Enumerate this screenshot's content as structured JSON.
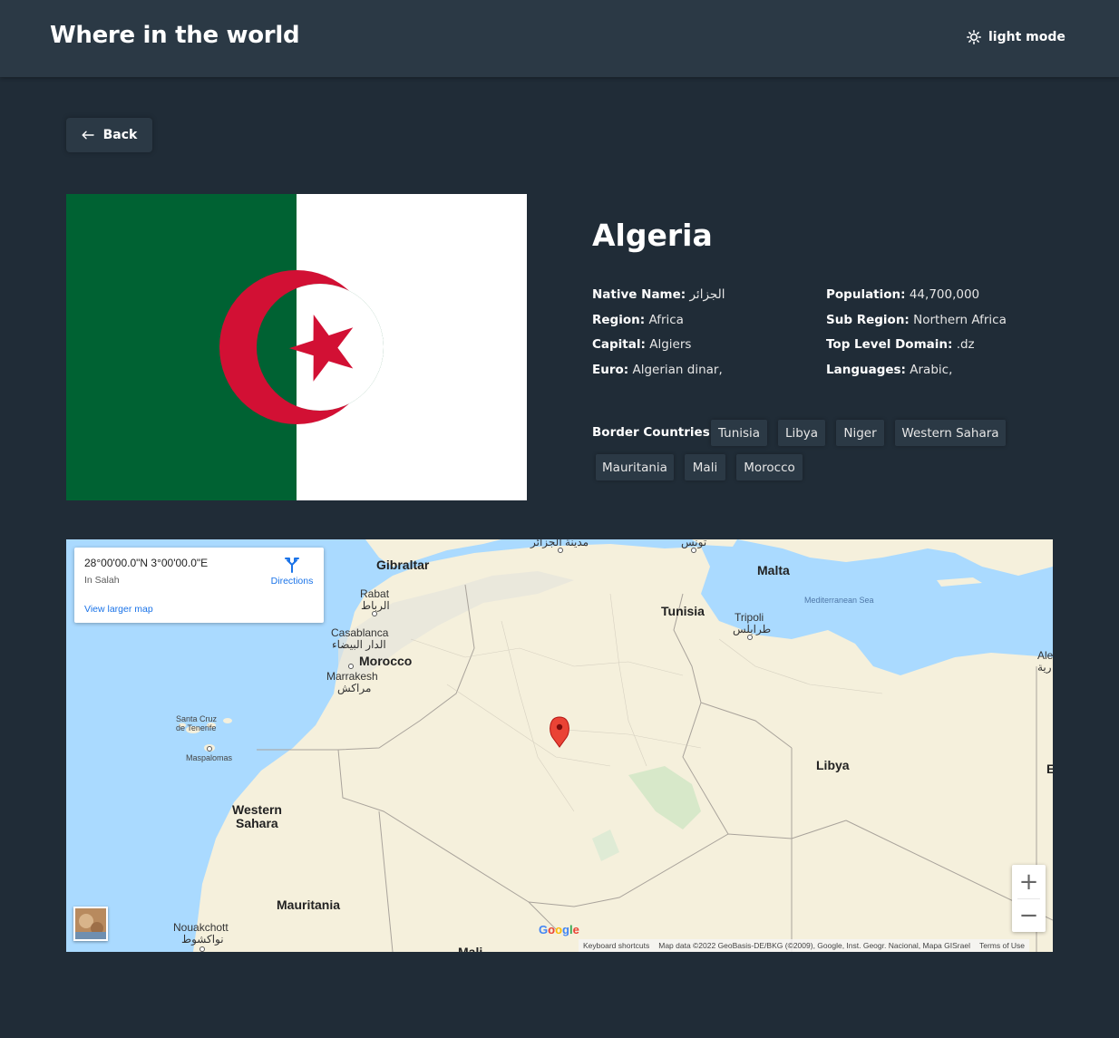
{
  "header": {
    "title": "Where in the world",
    "theme_label": "light mode",
    "theme_icon": "sun-icon"
  },
  "back_button": {
    "label": "Back",
    "icon": "arrow-left-icon"
  },
  "country": {
    "name": "Algeria",
    "native_name_label": "Native Name:",
    "native_name": "الجزائر",
    "region_label": "Region:",
    "region": "Africa",
    "capital_label": "Capital:",
    "capital": "Algiers",
    "currency_label": "Euro:",
    "currency": "Algerian dinar,",
    "population_label": "Population:",
    "population": "44,700,000",
    "subregion_label": "Sub Region:",
    "subregion": "Northern Africa",
    "tld_label": "Top Level Domain:",
    "tld": ".dz",
    "languages_label": "Languages:",
    "languages": "Arabic,",
    "border_label": "Border Countries:",
    "borders": [
      "Tunisia",
      "Libya",
      "Niger",
      "Western Sahara",
      "Mauritania",
      "Mali",
      "Morocco"
    ]
  },
  "flag": {
    "colors": {
      "green": "#006233",
      "white": "#ffffff",
      "red": "#d21034"
    }
  },
  "map": {
    "coords": "28°00'00.0\"N 3°00'00.0\"E",
    "place": "In Salah",
    "view_larger": "View larger map",
    "directions": "Directions",
    "labels": {
      "gibraltar": "Gibraltar",
      "malta": "Malta",
      "rabat": "Rabat",
      "rabat_ar": "الرباط",
      "casablanca": "Casablanca",
      "casablanca_ar": "الدار البيضاء",
      "morocco": "Morocco",
      "marrakesh": "Marrakesh",
      "marrakesh_ar": "مراكش",
      "tunisia": "Tunisia",
      "tripoli": "Tripoli",
      "tripoli_ar": "طرابلس",
      "med_sea": "Mediterranean Sea",
      "libya": "Libya",
      "santa_cruz": "Santa Cruz",
      "de_tenerife": "de Tenerife",
      "maspalomas": "Maspalomas",
      "western": "Western",
      "sahara": "Sahara",
      "mauritania": "Mauritania",
      "nouakchott": "Nouakchott",
      "nouakchott_ar": "نواكشوط",
      "algiers_ar": "مدينة الجزائر",
      "tunis_ar": "تونس",
      "alex_1": "Ale",
      "alex_2": "رية",
      "egypt_e": "E",
      "mali": "Mali"
    },
    "zoom_in": "+",
    "zoom_out": "−",
    "google": "Google",
    "shortcuts": "Keyboard shortcuts",
    "map_data": "Map data ©2022 GeoBasis-DE/BKG (©2009), Google, Inst. Geogr. Nacional, Mapa GISrael",
    "terms": "Terms of Use"
  }
}
